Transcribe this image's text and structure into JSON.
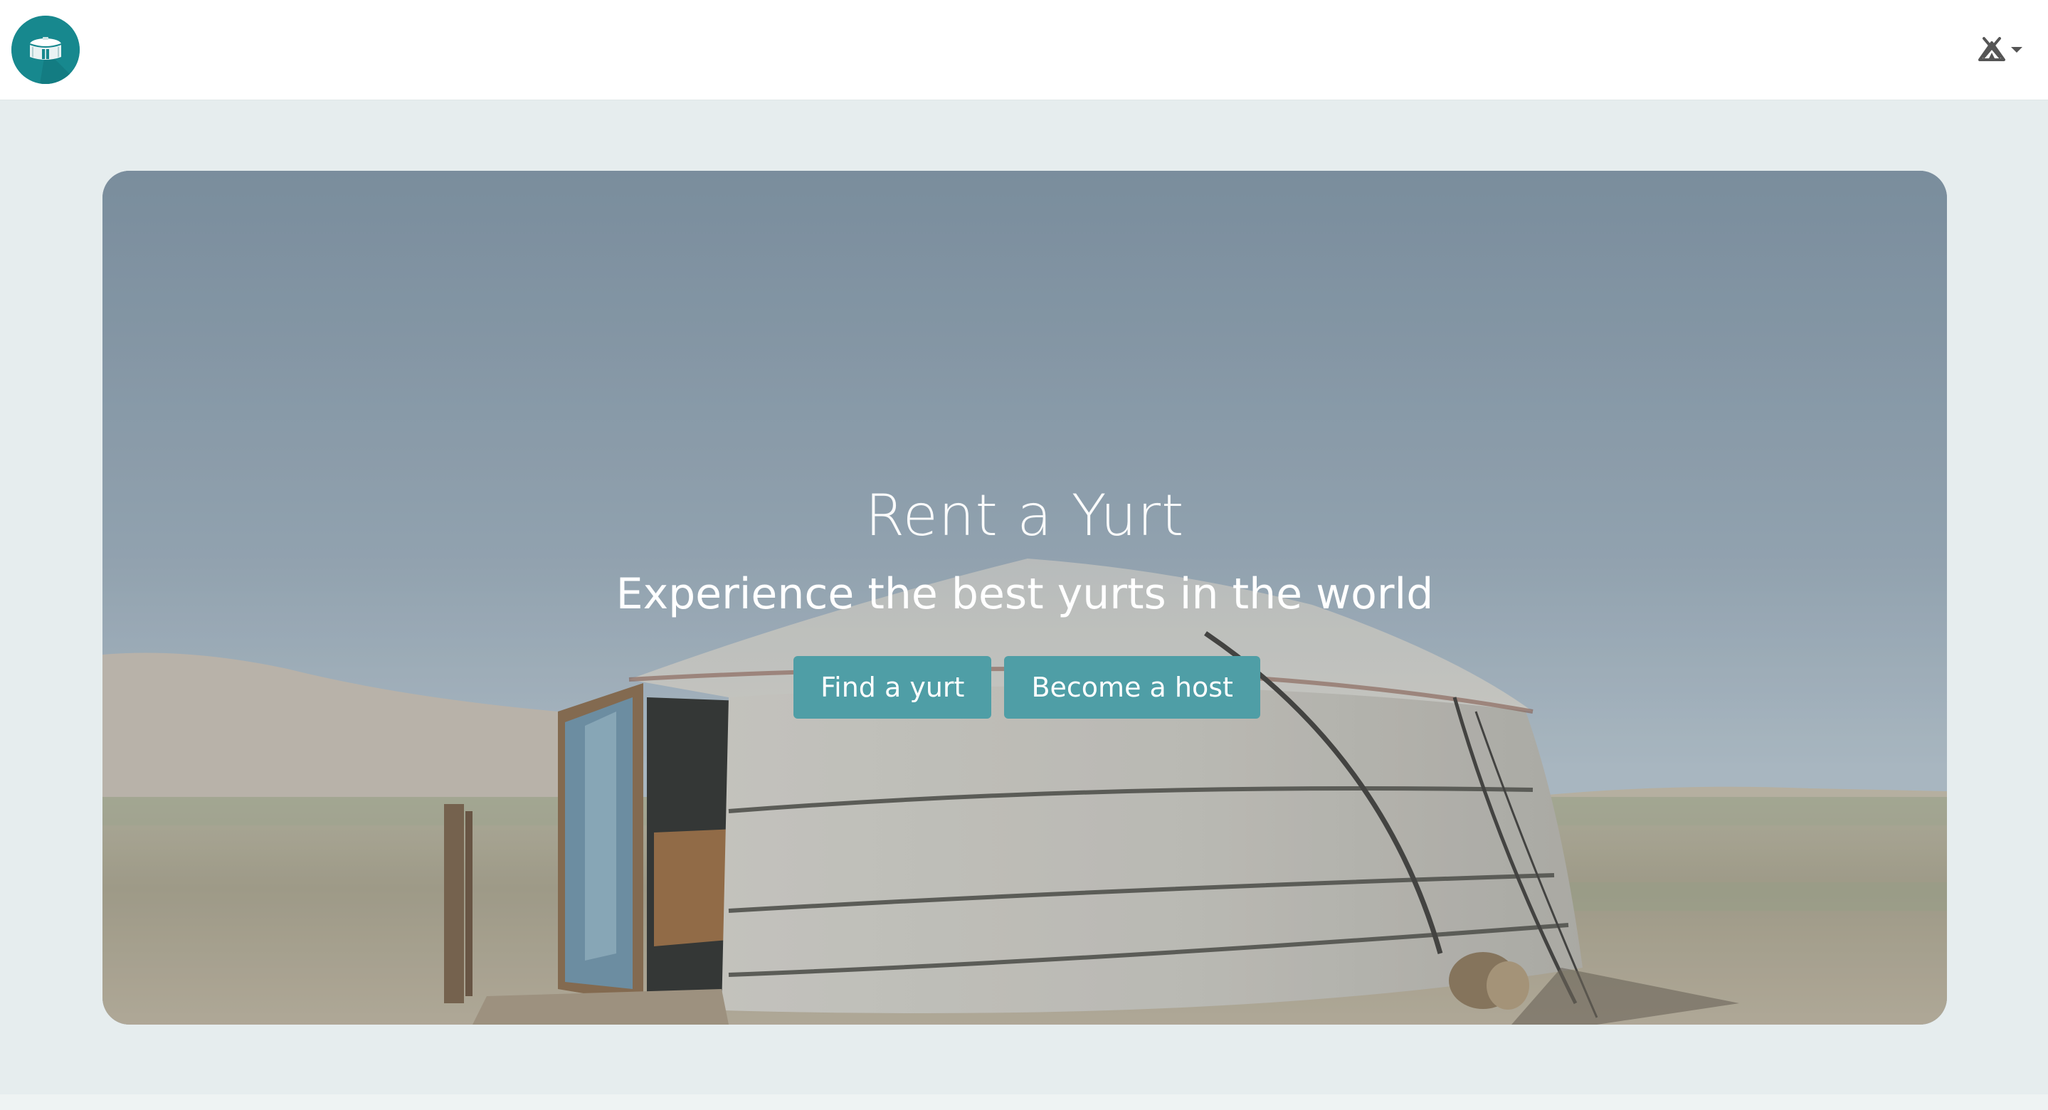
{
  "navbar": {
    "logo_icon": "yurt-logo-icon",
    "user_menu_icon": "tent-icon",
    "dropdown_icon": "caret-down-icon"
  },
  "hero": {
    "title": "Rent a Yurt",
    "subtitle": "Experience the best yurts in the world",
    "buttons": {
      "find_label": "Find a yurt",
      "host_label": "Become a host"
    },
    "background": "yurt-in-steppe-photo"
  },
  "colors": {
    "brand": "#17888e",
    "button": "#4f9ea6",
    "page_background": "#e6edee",
    "navbar_background": "#ffffff"
  }
}
